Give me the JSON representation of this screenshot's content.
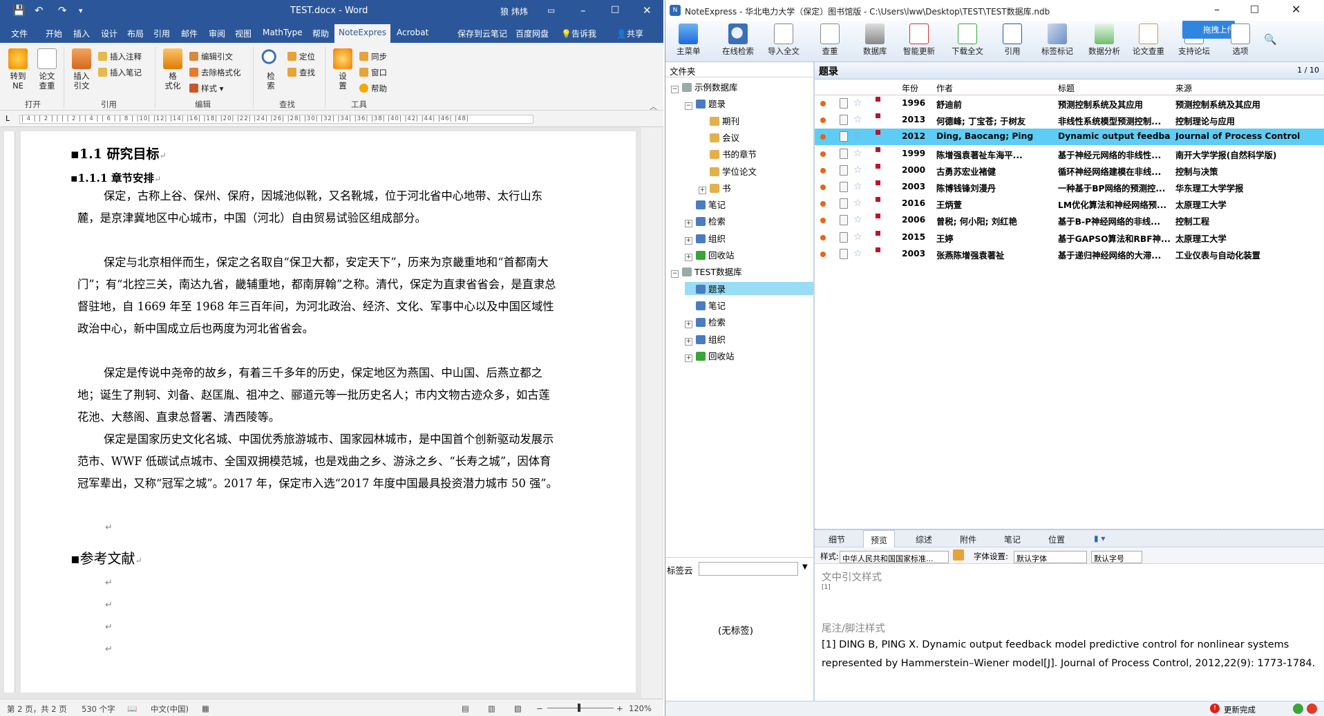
{
  "word": {
    "title": "TEST.docx  -  Word",
    "user": "狼 炜炜",
    "tabs": [
      "文件",
      "开始",
      "插入",
      "设计",
      "布局",
      "引用",
      "邮件",
      "审阅",
      "视图",
      "MathType",
      "帮助",
      "NoteExpres",
      "Acrobat",
      "保存到云笔记",
      "百度网盘",
      "告诉我",
      "共享"
    ],
    "ribbon": {
      "goto_ne": "转到\nNE",
      "paper_check": "论文\n查重",
      "insert_cite": "插入\n引文",
      "insert_note": "插入注释",
      "insert_notes2": "插入笔记",
      "format": "格\n式化",
      "edit_cite": "编辑引文",
      "remove_format": "去除格式化",
      "style": "样式",
      "search": "检\n索",
      "locate": "定位",
      "find": "查找",
      "settings": "设\n置",
      "sync": "同步",
      "window": "窗口",
      "help": "帮助",
      "groups": [
        "打开",
        "引用",
        "编辑",
        "查找",
        "工具"
      ]
    },
    "ruler": "| 4 |  | 2 |  |  |  | 2 |  | 4 |  | 6 |  | 8 |  |10|  |12|  |14|  |16|  |18|  |20|  |22|  |24|  |26|  |28|  |30|  |32|  |34|  |36|  |38|  |40|  |42|  |44|  |46|  |48|",
    "heading1": "1.1 研究目标",
    "heading2": "1.1.1 章节安排",
    "paragraphs": [
      "保定，古称上谷、保州、保府，因城池似靴，又名靴城，位于河北省中心地带、太行山东麓，是京津冀地区中心城市，中国（河北）自由贸易试验区组成部分。",
      "保定与北京相伴而生，保定之名取自“保卫大都，安定天下”，历来为京畿重地和“首都南大门”；有“北控三关，南达九省，畿辅重地，都南屏翰”之称。清代，保定为直隶省省会，是直隶总督驻地，自 1669 年至 1968 年三百年间，为河北政治、经济、文化、军事中心以及中国区域性政治中心，新中国成立后也两度为河北省省会。",
      "保定是传说中尧帝的故乡，有着三千多年的历史，保定地区为燕国、中山国、后燕立都之地；诞生了荆轲、刘备、赵匡胤、祖冲之、郦道元等一批历史名人；市内文物古迹众多，如古莲花池、大慈阁、直隶总督署、清西陵等。",
      "保定是国家历史文化名城、中国优秀旅游城市、国家园林城市，是中国首个创新驱动发展示范市、WWF 低碳试点城市、全国双拥模范城，也是戏曲之乡、游泳之乡、“长寿之城”，因体育冠军辈出，又称“冠军之城”。2017 年，保定市入选“2017 年度中国最具投资潜力城市 50 强”。"
    ],
    "references_heading": "参考文献",
    "status": {
      "page": "第 2 页，共 2 页",
      "words": "530 个字",
      "lang": "中文(中国)",
      "zoom": "120%"
    }
  },
  "ne": {
    "title": "NoteExpress - 华北电力大学（保定）图书馆版 - C:\\Users\\lww\\Desktop\\TEST\\TEST数据库.ndb",
    "toolbar": [
      "主菜单",
      "在线检索",
      "导入全文",
      "查重",
      "数据库",
      "智能更新",
      "下载全文",
      "引用",
      "标签标记",
      "数据分析",
      "论文查重",
      "支持论坛",
      "选项"
    ],
    "upload": "拖拽上传",
    "folder_header": "文件夹",
    "tree": [
      {
        "label": "示例数据库",
        "indent": 0,
        "exp": "−"
      },
      {
        "label": "题录",
        "indent": 1,
        "exp": "−"
      },
      {
        "label": "期刊",
        "indent": 2,
        "exp": ""
      },
      {
        "label": "会议",
        "indent": 2,
        "exp": ""
      },
      {
        "label": "书的章节",
        "indent": 2,
        "exp": ""
      },
      {
        "label": "学位论文",
        "indent": 2,
        "exp": ""
      },
      {
        "label": "书",
        "indent": 2,
        "exp": "+"
      },
      {
        "label": "笔记",
        "indent": 1,
        "exp": ""
      },
      {
        "label": "检索",
        "indent": 1,
        "exp": "+"
      },
      {
        "label": "组织",
        "indent": 1,
        "exp": "+"
      },
      {
        "label": "回收站",
        "indent": 1,
        "exp": "+"
      },
      {
        "label": "TEST数据库",
        "indent": 0,
        "exp": "−"
      },
      {
        "label": "题录",
        "indent": 1,
        "exp": "",
        "selected": true
      },
      {
        "label": "笔记",
        "indent": 1,
        "exp": ""
      },
      {
        "label": "检索",
        "indent": 1,
        "exp": "+"
      },
      {
        "label": "组织",
        "indent": 1,
        "exp": "+"
      },
      {
        "label": "回收站",
        "indent": 1,
        "exp": "+"
      }
    ],
    "tag_cloud_label": "标签云",
    "no_tags": "(无标签)",
    "list_title": "题录",
    "page_count": "1 / 10",
    "columns": [
      "年份",
      "作者",
      "标题",
      "来源"
    ],
    "rows": [
      {
        "year": "1996",
        "author": "舒迪前",
        "title": "预测控制系统及其应用",
        "source": "预测控制系统及其应用"
      },
      {
        "year": "2013",
        "author": "何德峰; 丁宝苍; 于树友",
        "title": "非线性系统模型预测控制...",
        "source": "控制理论与应用"
      },
      {
        "year": "2012",
        "author": "Ding, Baocang; Ping",
        "title": "Dynamic output feedba...",
        "source": "Journal of Process Control",
        "selected": true
      },
      {
        "year": "1999",
        "author": "陈增强袁著祉车海平...",
        "title": "基于神经元网络的非线性...",
        "source": "南开大学学报(自然科学版)"
      },
      {
        "year": "2000",
        "author": "古勇苏宏业褚健",
        "title": "循环神经网络建模在非线...",
        "source": "控制与决策"
      },
      {
        "year": "2003",
        "author": "陈博钱锋刘漫丹",
        "title": "一种基于BP网络的预测控...",
        "source": "华东理工大学学报"
      },
      {
        "year": "2016",
        "author": "王炳萱",
        "title": "LM优化算法和神经网络预...",
        "source": "太原理工大学"
      },
      {
        "year": "2006",
        "author": "曾税; 何小阳; 刘红艳",
        "title": "基于B-P神经网络的非线...",
        "source": "控制工程"
      },
      {
        "year": "2015",
        "author": "王婷",
        "title": "基于GAPSO算法和RBF神...",
        "source": "太原理工大学"
      },
      {
        "year": "2003",
        "author": "张燕陈增强袁著祉",
        "title": "基于递归神经网络的大滞...",
        "source": "工业仪表与自动化装置"
      }
    ],
    "tabs": [
      "细节",
      "预览",
      "综述",
      "附件",
      "笔记",
      "位置"
    ],
    "style_label": "样式:",
    "style_value": "中华人民共和国国家标准...",
    "font_label": "字体设置:",
    "font_value": "默认字体",
    "size_value": "默认字号",
    "intext_title": "文中引文样式",
    "intext_value": "[1]",
    "footnote_title": "尾注/脚注样式",
    "footnote_value": "[1]      DING B, PING X. Dynamic output feedback model predictive control for nonlinear systems represented by Hammerstein–Wiener model[J]. Journal of Process Control, 2012,22(9): 1773-1784.",
    "status": "更新完成"
  }
}
